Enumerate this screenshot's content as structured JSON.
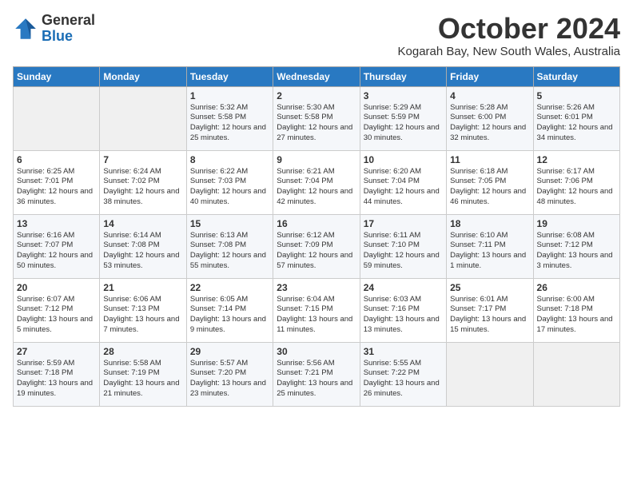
{
  "header": {
    "logo_line1": "General",
    "logo_line2": "Blue",
    "month": "October 2024",
    "location": "Kogarah Bay, New South Wales, Australia"
  },
  "days_of_week": [
    "Sunday",
    "Monday",
    "Tuesday",
    "Wednesday",
    "Thursday",
    "Friday",
    "Saturday"
  ],
  "weeks": [
    [
      {
        "day": null
      },
      {
        "day": null
      },
      {
        "day": "1",
        "sunrise": "Sunrise: 5:32 AM",
        "sunset": "Sunset: 5:58 PM",
        "daylight": "Daylight: 12 hours and 25 minutes."
      },
      {
        "day": "2",
        "sunrise": "Sunrise: 5:30 AM",
        "sunset": "Sunset: 5:58 PM",
        "daylight": "Daylight: 12 hours and 27 minutes."
      },
      {
        "day": "3",
        "sunrise": "Sunrise: 5:29 AM",
        "sunset": "Sunset: 5:59 PM",
        "daylight": "Daylight: 12 hours and 30 minutes."
      },
      {
        "day": "4",
        "sunrise": "Sunrise: 5:28 AM",
        "sunset": "Sunset: 6:00 PM",
        "daylight": "Daylight: 12 hours and 32 minutes."
      },
      {
        "day": "5",
        "sunrise": "Sunrise: 5:26 AM",
        "sunset": "Sunset: 6:01 PM",
        "daylight": "Daylight: 12 hours and 34 minutes."
      }
    ],
    [
      {
        "day": "6",
        "sunrise": "Sunrise: 6:25 AM",
        "sunset": "Sunset: 7:01 PM",
        "daylight": "Daylight: 12 hours and 36 minutes."
      },
      {
        "day": "7",
        "sunrise": "Sunrise: 6:24 AM",
        "sunset": "Sunset: 7:02 PM",
        "daylight": "Daylight: 12 hours and 38 minutes."
      },
      {
        "day": "8",
        "sunrise": "Sunrise: 6:22 AM",
        "sunset": "Sunset: 7:03 PM",
        "daylight": "Daylight: 12 hours and 40 minutes."
      },
      {
        "day": "9",
        "sunrise": "Sunrise: 6:21 AM",
        "sunset": "Sunset: 7:04 PM",
        "daylight": "Daylight: 12 hours and 42 minutes."
      },
      {
        "day": "10",
        "sunrise": "Sunrise: 6:20 AM",
        "sunset": "Sunset: 7:04 PM",
        "daylight": "Daylight: 12 hours and 44 minutes."
      },
      {
        "day": "11",
        "sunrise": "Sunrise: 6:18 AM",
        "sunset": "Sunset: 7:05 PM",
        "daylight": "Daylight: 12 hours and 46 minutes."
      },
      {
        "day": "12",
        "sunrise": "Sunrise: 6:17 AM",
        "sunset": "Sunset: 7:06 PM",
        "daylight": "Daylight: 12 hours and 48 minutes."
      }
    ],
    [
      {
        "day": "13",
        "sunrise": "Sunrise: 6:16 AM",
        "sunset": "Sunset: 7:07 PM",
        "daylight": "Daylight: 12 hours and 50 minutes."
      },
      {
        "day": "14",
        "sunrise": "Sunrise: 6:14 AM",
        "sunset": "Sunset: 7:08 PM",
        "daylight": "Daylight: 12 hours and 53 minutes."
      },
      {
        "day": "15",
        "sunrise": "Sunrise: 6:13 AM",
        "sunset": "Sunset: 7:08 PM",
        "daylight": "Daylight: 12 hours and 55 minutes."
      },
      {
        "day": "16",
        "sunrise": "Sunrise: 6:12 AM",
        "sunset": "Sunset: 7:09 PM",
        "daylight": "Daylight: 12 hours and 57 minutes."
      },
      {
        "day": "17",
        "sunrise": "Sunrise: 6:11 AM",
        "sunset": "Sunset: 7:10 PM",
        "daylight": "Daylight: 12 hours and 59 minutes."
      },
      {
        "day": "18",
        "sunrise": "Sunrise: 6:10 AM",
        "sunset": "Sunset: 7:11 PM",
        "daylight": "Daylight: 13 hours and 1 minute."
      },
      {
        "day": "19",
        "sunrise": "Sunrise: 6:08 AM",
        "sunset": "Sunset: 7:12 PM",
        "daylight": "Daylight: 13 hours and 3 minutes."
      }
    ],
    [
      {
        "day": "20",
        "sunrise": "Sunrise: 6:07 AM",
        "sunset": "Sunset: 7:12 PM",
        "daylight": "Daylight: 13 hours and 5 minutes."
      },
      {
        "day": "21",
        "sunrise": "Sunrise: 6:06 AM",
        "sunset": "Sunset: 7:13 PM",
        "daylight": "Daylight: 13 hours and 7 minutes."
      },
      {
        "day": "22",
        "sunrise": "Sunrise: 6:05 AM",
        "sunset": "Sunset: 7:14 PM",
        "daylight": "Daylight: 13 hours and 9 minutes."
      },
      {
        "day": "23",
        "sunrise": "Sunrise: 6:04 AM",
        "sunset": "Sunset: 7:15 PM",
        "daylight": "Daylight: 13 hours and 11 minutes."
      },
      {
        "day": "24",
        "sunrise": "Sunrise: 6:03 AM",
        "sunset": "Sunset: 7:16 PM",
        "daylight": "Daylight: 13 hours and 13 minutes."
      },
      {
        "day": "25",
        "sunrise": "Sunrise: 6:01 AM",
        "sunset": "Sunset: 7:17 PM",
        "daylight": "Daylight: 13 hours and 15 minutes."
      },
      {
        "day": "26",
        "sunrise": "Sunrise: 6:00 AM",
        "sunset": "Sunset: 7:18 PM",
        "daylight": "Daylight: 13 hours and 17 minutes."
      }
    ],
    [
      {
        "day": "27",
        "sunrise": "Sunrise: 5:59 AM",
        "sunset": "Sunset: 7:18 PM",
        "daylight": "Daylight: 13 hours and 19 minutes."
      },
      {
        "day": "28",
        "sunrise": "Sunrise: 5:58 AM",
        "sunset": "Sunset: 7:19 PM",
        "daylight": "Daylight: 13 hours and 21 minutes."
      },
      {
        "day": "29",
        "sunrise": "Sunrise: 5:57 AM",
        "sunset": "Sunset: 7:20 PM",
        "daylight": "Daylight: 13 hours and 23 minutes."
      },
      {
        "day": "30",
        "sunrise": "Sunrise: 5:56 AM",
        "sunset": "Sunset: 7:21 PM",
        "daylight": "Daylight: 13 hours and 25 minutes."
      },
      {
        "day": "31",
        "sunrise": "Sunrise: 5:55 AM",
        "sunset": "Sunset: 7:22 PM",
        "daylight": "Daylight: 13 hours and 26 minutes."
      },
      {
        "day": null
      },
      {
        "day": null
      }
    ]
  ]
}
